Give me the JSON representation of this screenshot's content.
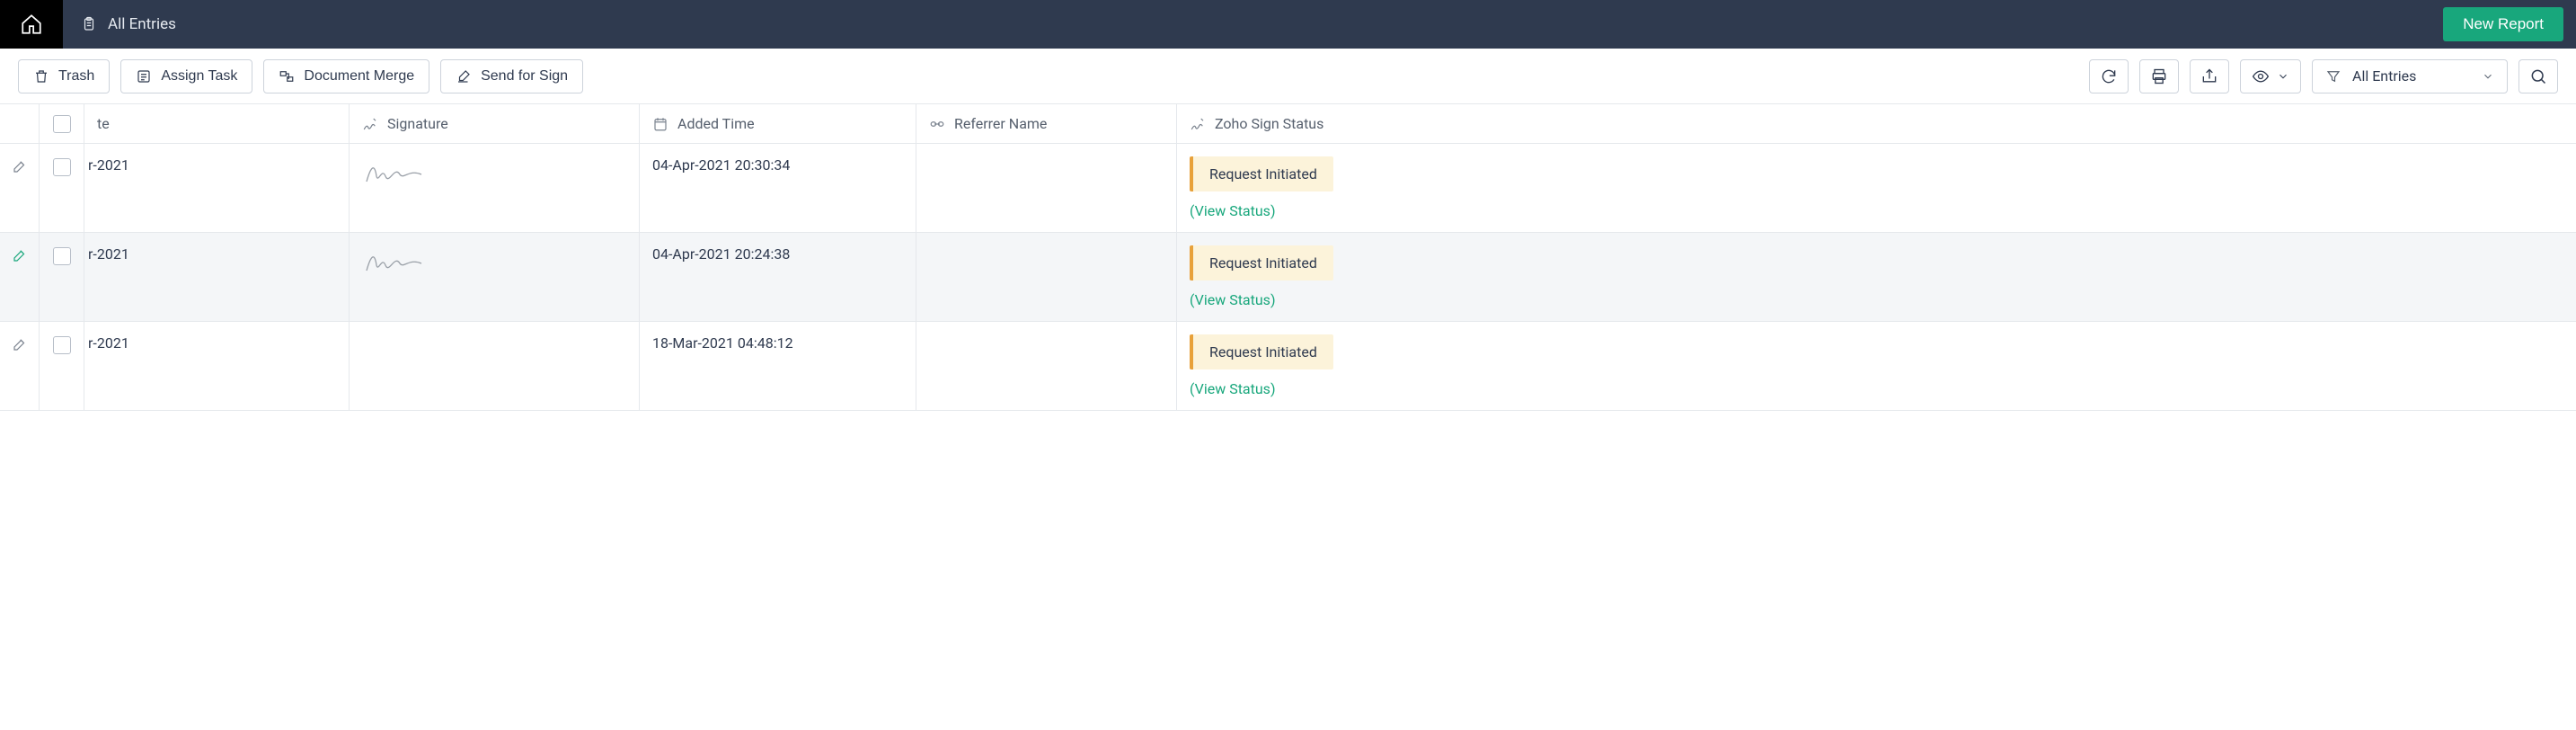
{
  "header": {
    "page_title": "All Entries",
    "new_report_label": "New Report"
  },
  "toolbar": {
    "trash_label": "Trash",
    "assign_task_label": "Assign Task",
    "doc_merge_label": "Document Merge",
    "send_sign_label": "Send for Sign",
    "filter_selected": "All Entries"
  },
  "columns": {
    "date": "te",
    "signature": "Signature",
    "added_time": "Added Time",
    "referrer": "Referrer Name",
    "sign_status": "Zoho Sign Status"
  },
  "rows": [
    {
      "date_fragment": "r-2021",
      "added_time": "04-Apr-2021 20:30:34",
      "referrer": "",
      "status_label": "Request Initiated",
      "view_status_label": "(View Status)",
      "has_signature": true,
      "hover": false,
      "edit_green": false
    },
    {
      "date_fragment": "r-2021",
      "added_time": "04-Apr-2021 20:24:38",
      "referrer": "",
      "status_label": "Request Initiated",
      "view_status_label": "(View Status)",
      "has_signature": true,
      "hover": true,
      "edit_green": true
    },
    {
      "date_fragment": "r-2021",
      "added_time": "18-Mar-2021 04:48:12",
      "referrer": "",
      "status_label": "Request Initiated",
      "view_status_label": "(View Status)",
      "has_signature": false,
      "hover": false,
      "edit_green": false
    }
  ]
}
